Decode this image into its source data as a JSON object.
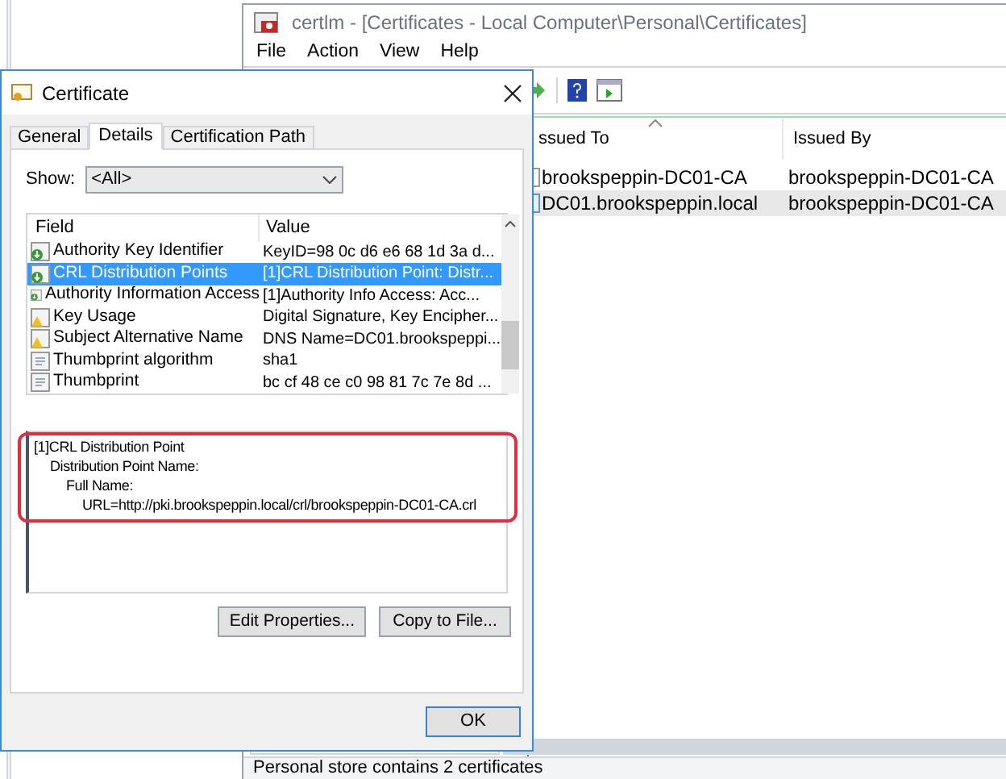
{
  "main_window": {
    "title": "certlm - [Certificates - Local Computer\\Personal\\Certificates]",
    "menu": [
      "File",
      "Action",
      "View",
      "Help"
    ],
    "columns": [
      "ssued To",
      "Issued By"
    ],
    "rows": [
      {
        "issued_to": "brookspeppin-DC01-CA",
        "issued_by": "brookspeppin-DC01-CA",
        "kind": "root",
        "selected": false
      },
      {
        "issued_to": "DC01.brookspeppin.local",
        "issued_by": "brookspeppin-DC01-CA",
        "kind": "leaf",
        "selected": true
      }
    ],
    "status_bar": "Personal store contains 2 certificates"
  },
  "dialog": {
    "title": "Certificate",
    "tabs": [
      {
        "label": "General",
        "selected": false
      },
      {
        "label": "Details",
        "selected": true
      },
      {
        "label": "Certification Path",
        "selected": false
      }
    ],
    "show_label": "Show:",
    "show_value": "<All>",
    "columns": [
      "Field",
      "Value"
    ],
    "fields": [
      {
        "name": "Authority Key Identifier",
        "value": "KeyID=98 0c d6 e6 68 1d 3a d...",
        "kind": "extension",
        "selected": false
      },
      {
        "name": "CRL Distribution Points",
        "value": "[1]CRL Distribution Point: Distr...",
        "kind": "extension",
        "selected": true
      },
      {
        "name": "Authority Information Access",
        "value": "[1]Authority Info Access: Acc...",
        "kind": "extension",
        "selected": false
      },
      {
        "name": "Key Usage",
        "value": "Digital Signature, Key Encipher...",
        "kind": "critical",
        "selected": false
      },
      {
        "name": "Subject Alternative Name",
        "value": "DNS Name=DC01.brookspeppi...",
        "kind": "critical",
        "selected": false
      },
      {
        "name": "Thumbprint algorithm",
        "value": "sha1",
        "kind": "property",
        "selected": false
      },
      {
        "name": "Thumbprint",
        "value": "bc cf 48 ce c0 98 81 7c 7e 8d ...",
        "kind": "property",
        "selected": false
      }
    ],
    "details": [
      {
        "text": "[1]CRL Distribution Point",
        "children": [
          {
            "text": "Distribution Point Name:",
            "children": [
              {
                "text": "Full Name:",
                "children": [
                  {
                    "text": "URL=http://pki.brookspeppin.local/crl/brookspeppin-DC01-CA.crl"
                  }
                ]
              }
            ]
          }
        ]
      }
    ],
    "buttons": [
      "Edit Properties...",
      "Copy to File..."
    ],
    "ok_button": "OK"
  }
}
